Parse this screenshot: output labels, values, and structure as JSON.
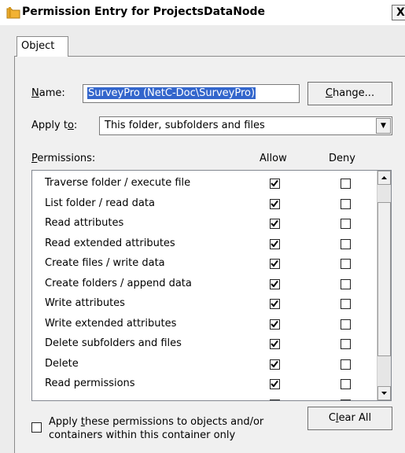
{
  "window": {
    "title": "Permission Entry for ProjectsDataNode",
    "close_label": "X"
  },
  "tabs": [
    {
      "label": "Object"
    }
  ],
  "name_field": {
    "label_prefix": "",
    "label_key": "N",
    "label_rest": "ame:",
    "value": "SurveyPro (NetC-Doc\\SurveyPro)"
  },
  "change_button": {
    "key": "C",
    "rest": "hange..."
  },
  "apply_to": {
    "label_prefix": "Apply t",
    "label_key": "o",
    "label_rest": ":",
    "value": "This folder, subfolders and files"
  },
  "permissions": {
    "label_key": "P",
    "label_rest": "ermissions:",
    "allow_header": "Allow",
    "deny_header": "Deny",
    "items": [
      {
        "name": "Traverse folder / execute file",
        "allow": true,
        "deny": false
      },
      {
        "name": "List folder / read data",
        "allow": true,
        "deny": false
      },
      {
        "name": "Read attributes",
        "allow": true,
        "deny": false
      },
      {
        "name": "Read extended attributes",
        "allow": true,
        "deny": false
      },
      {
        "name": "Create files / write data",
        "allow": true,
        "deny": false
      },
      {
        "name": "Create folders / append data",
        "allow": true,
        "deny": false
      },
      {
        "name": "Write attributes",
        "allow": true,
        "deny": false
      },
      {
        "name": "Write extended attributes",
        "allow": true,
        "deny": false
      },
      {
        "name": "Delete subfolders and files",
        "allow": true,
        "deny": false
      },
      {
        "name": "Delete",
        "allow": true,
        "deny": false
      },
      {
        "name": "Read permissions",
        "allow": true,
        "deny": false
      },
      {
        "name": "",
        "allow": true,
        "deny": false
      }
    ]
  },
  "apply_checkbox": {
    "line1_prefix": "Apply ",
    "line1_key": "t",
    "line1_rest": "hese permissions to objects and/or",
    "line2": "containers within this container only",
    "checked": false
  },
  "clear_all_button": {
    "prefix": "C",
    "key": "l",
    "rest": "ear All"
  },
  "colors": {
    "selection": "#3366cc",
    "folder": "#e8a317"
  }
}
